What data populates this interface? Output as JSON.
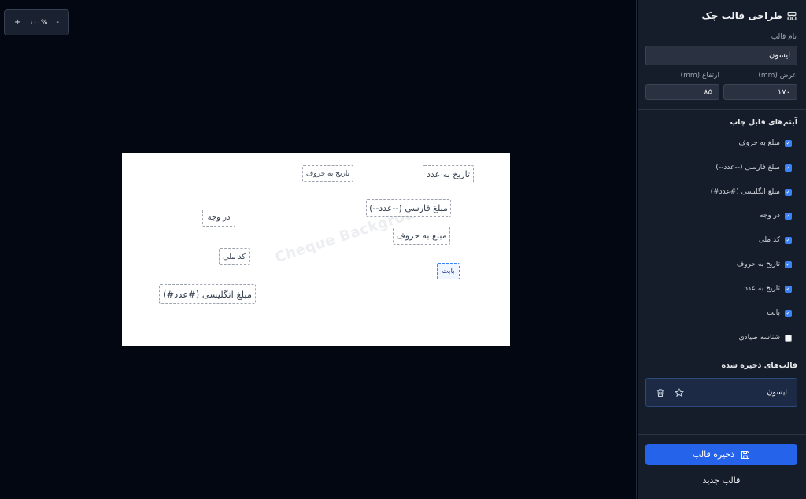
{
  "zoom": {
    "plus": "+",
    "value": "۱۰۰%",
    "minus": "-"
  },
  "canvas": {
    "watermark": "Cheque Background",
    "fields": [
      {
        "name": "field-date-words",
        "text": "تاریخ به حروف"
      },
      {
        "name": "field-date-number",
        "text": "تاریخ به عدد"
      },
      {
        "name": "field-payee",
        "text": "در وجه"
      },
      {
        "name": "field-amount-persian",
        "text": "مبلغ فارسی (--عدد--)"
      },
      {
        "name": "field-amount-words",
        "text": "مبلغ به حروف"
      },
      {
        "name": "field-national-code",
        "text": "کد ملی"
      },
      {
        "name": "field-reason",
        "text": "بابت"
      },
      {
        "name": "field-amount-english",
        "text": "مبلغ انگلیسی (#عدد#)"
      }
    ]
  },
  "panel": {
    "title": "طراحی قالب چک",
    "template_name_label": "نام قالب",
    "template_name_value": "ایسون",
    "width_label": "عرض (mm)",
    "width_value": "۱۷۰",
    "height_label": "ارتفاع (mm)",
    "height_value": "۸۵",
    "printable_title": "آیتم‌های قابل چاپ",
    "items": [
      {
        "label": "مبلغ به حروف",
        "checked": true
      },
      {
        "label": "مبلغ فارسی (--عدد--)",
        "checked": true
      },
      {
        "label": "مبلغ انگلیسی (#عدد#)",
        "checked": true
      },
      {
        "label": "در وجه",
        "checked": true
      },
      {
        "label": "کد ملی",
        "checked": true
      },
      {
        "label": "تاریخ به حروف",
        "checked": true
      },
      {
        "label": "تاریخ به عدد",
        "checked": true
      },
      {
        "label": "بابت",
        "checked": true
      },
      {
        "label": "شناسه صیادی",
        "checked": false
      }
    ],
    "saved_title": "قالب‌های ذخیره شده",
    "saved_templates": [
      {
        "name": "ایسون"
      }
    ],
    "save_button": "ذخیره قالب",
    "new_button": "قالب جدید"
  },
  "colors": {
    "accent": "#2563eb",
    "panel_bg": "#161d2a",
    "canvas_bg": "#030712",
    "paper": "#ffffff"
  }
}
